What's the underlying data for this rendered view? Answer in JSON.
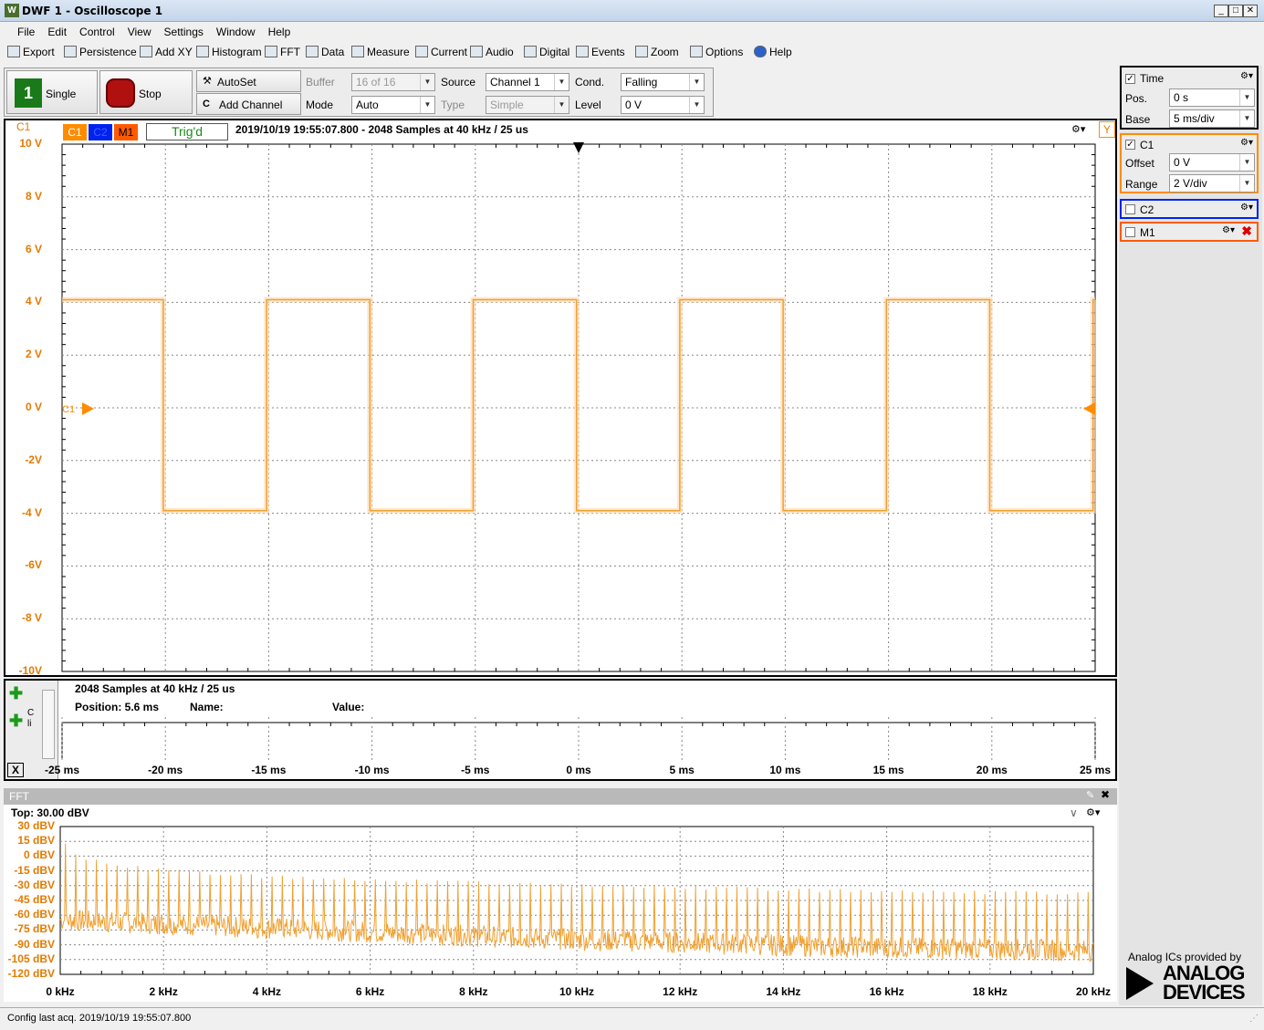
{
  "window": {
    "title": "DWF 1 - Oscilloscope 1",
    "app_icon": "W"
  },
  "menu": [
    "File",
    "Edit",
    "Control",
    "View",
    "Settings",
    "Window",
    "Help"
  ],
  "toolbar": [
    {
      "label": "Export",
      "icon": "export-icon"
    },
    {
      "label": "Persistence",
      "icon": "persistence-icon"
    },
    {
      "label": "Add XY",
      "icon": "xy-icon"
    },
    {
      "label": "Histogram",
      "icon": "histogram-icon"
    },
    {
      "label": "FFT",
      "icon": "fft-icon"
    },
    {
      "label": "Data",
      "icon": "data-icon"
    },
    {
      "label": "Measure",
      "icon": "measure-icon"
    },
    {
      "label": "Current",
      "icon": "current-icon"
    },
    {
      "label": "Audio",
      "icon": "audio-icon"
    },
    {
      "label": "Digital",
      "icon": "digital-icon"
    },
    {
      "label": "Events",
      "icon": "events-icon"
    },
    {
      "label": "Zoom",
      "icon": "zoom-icon"
    },
    {
      "label": "Options",
      "icon": "options-icon"
    },
    {
      "label": "Help",
      "icon": "help-icon"
    }
  ],
  "controls": {
    "single": "Single",
    "single_icon_text": "1",
    "stop": "Stop",
    "autoset": "AutoSet",
    "add_channel": "Add Channel",
    "add_channel_icon_text": "C",
    "buffer_label": "Buffer",
    "buffer_value": "16 of 16",
    "mode_label": "Mode",
    "mode_value": "Auto",
    "source_label": "Source",
    "source_value": "Channel 1",
    "type_label": "Type",
    "type_value": "Simple",
    "cond_label": "Cond.",
    "cond_value": "Falling",
    "level_label": "Level",
    "level_value": "0 V"
  },
  "right_panel": {
    "time": {
      "title": "Time",
      "pos_label": "Pos.",
      "pos_value": "0 s",
      "base_label": "Base",
      "base_value": "5 ms/div"
    },
    "c1": {
      "title": "C1",
      "offset_label": "Offset",
      "offset_value": "0 V",
      "range_label": "Range",
      "range_value": "2 V/div"
    },
    "c2": {
      "title": "C2"
    },
    "m1": {
      "title": "M1"
    }
  },
  "plot": {
    "channel_label": "C1",
    "tabs": [
      "C1",
      "C2",
      "M1"
    ],
    "trig_status": "Trig'd",
    "info": "2019/10/19  19:55:07.800 - 2048 Samples at 40 kHz / 25 us",
    "y_button": "Y",
    "marker_label": "C1",
    "y_ticks": [
      "10 V",
      "8 V",
      "6 V",
      "4 V",
      "2 V",
      "0 V",
      "-2V",
      "-4 V",
      "-6V",
      "-8 V",
      "-10V"
    ],
    "x_ticks": [
      "-25 ms",
      "-20 ms",
      "-15 ms",
      "-10 ms",
      "-5 ms",
      "0 ms",
      "5 ms",
      "10 ms",
      "15 ms",
      "20 ms",
      "25 ms"
    ]
  },
  "measure": {
    "samples": "2048 Samples at 40 kHz / 25 us",
    "position": "Position: 5.6 ms",
    "name": "Name:",
    "value": "Value:",
    "side_label": "C li",
    "close": "X"
  },
  "fft": {
    "bar_title": "FFT",
    "top": "Top: 30.00 dBV",
    "y_ticks": [
      "30 dBV",
      "15 dBV",
      "0 dBV",
      "-15 dBV",
      "-30 dBV",
      "-45 dBV",
      "-60 dBV",
      "-75 dBV",
      "-90 dBV",
      "-105 dBV",
      "-120 dBV"
    ],
    "x_ticks": [
      "0 kHz",
      "2 kHz",
      "4 kHz",
      "6 kHz",
      "8 kHz",
      "10 kHz",
      "12 kHz",
      "14 kHz",
      "16 kHz",
      "18 kHz",
      "20 kHz"
    ]
  },
  "branding": {
    "line1": "Analog ICs provided by",
    "line2": "ANALOG",
    "line3": "DEVICES"
  },
  "status": "Config last acq. 2019/10/19  19:55:07.800",
  "colors": {
    "c1": "#ff8c00",
    "c2": "#0022ee",
    "m1": "#ff5a00",
    "trace": "#f0a030"
  },
  "chart_data": [
    {
      "type": "line",
      "title": "",
      "xlabel": "",
      "ylabel": "",
      "x_unit": "ms",
      "y_unit": "V",
      "xlim": [
        -25,
        25
      ],
      "ylim": [
        -10,
        10
      ],
      "grid": true,
      "series": [
        {
          "name": "C1",
          "waveform": "square",
          "x": [
            -25,
            -20.1,
            -20.1,
            -15.1,
            -15.1,
            -10.1,
            -10.1,
            -5.1,
            -5.1,
            -0.1,
            -0.1,
            4.9,
            4.9,
            9.9,
            9.9,
            14.9,
            14.9,
            19.9,
            19.9,
            24.9,
            24.9,
            25
          ],
          "y": [
            4.1,
            4.1,
            -3.9,
            -3.9,
            4.1,
            4.1,
            -3.9,
            -3.9,
            4.1,
            4.1,
            -3.9,
            -3.9,
            4.1,
            4.1,
            -3.9,
            -3.9,
            4.1,
            4.1,
            -3.9,
            -3.9,
            4.1,
            4.1
          ]
        }
      ]
    },
    {
      "type": "line",
      "title": "",
      "xlabel": "",
      "ylabel": "",
      "x_unit": "kHz",
      "y_unit": "dBV",
      "xlim": [
        0,
        20
      ],
      "ylim": [
        -120,
        30
      ],
      "grid": true,
      "series": [
        {
          "name": "C1",
          "fundamental_khz": 0.1,
          "peak_envelope_dbv": [
            [
              0.1,
              13
            ],
            [
              0.3,
              4
            ],
            [
              0.5,
              -1
            ],
            [
              1,
              -7
            ],
            [
              2,
              -13
            ],
            [
              4,
              -19
            ],
            [
              6,
              -23
            ],
            [
              8,
              -25
            ],
            [
              10,
              -28
            ],
            [
              12,
              -30
            ],
            [
              14,
              -32
            ],
            [
              16,
              -34
            ],
            [
              18,
              -35
            ],
            [
              20,
              -36
            ]
          ],
          "floor_envelope_dbv": [
            [
              0,
              -65
            ],
            [
              5,
              -75
            ],
            [
              10,
              -85
            ],
            [
              15,
              -92
            ],
            [
              20,
              -96
            ]
          ]
        }
      ]
    }
  ]
}
